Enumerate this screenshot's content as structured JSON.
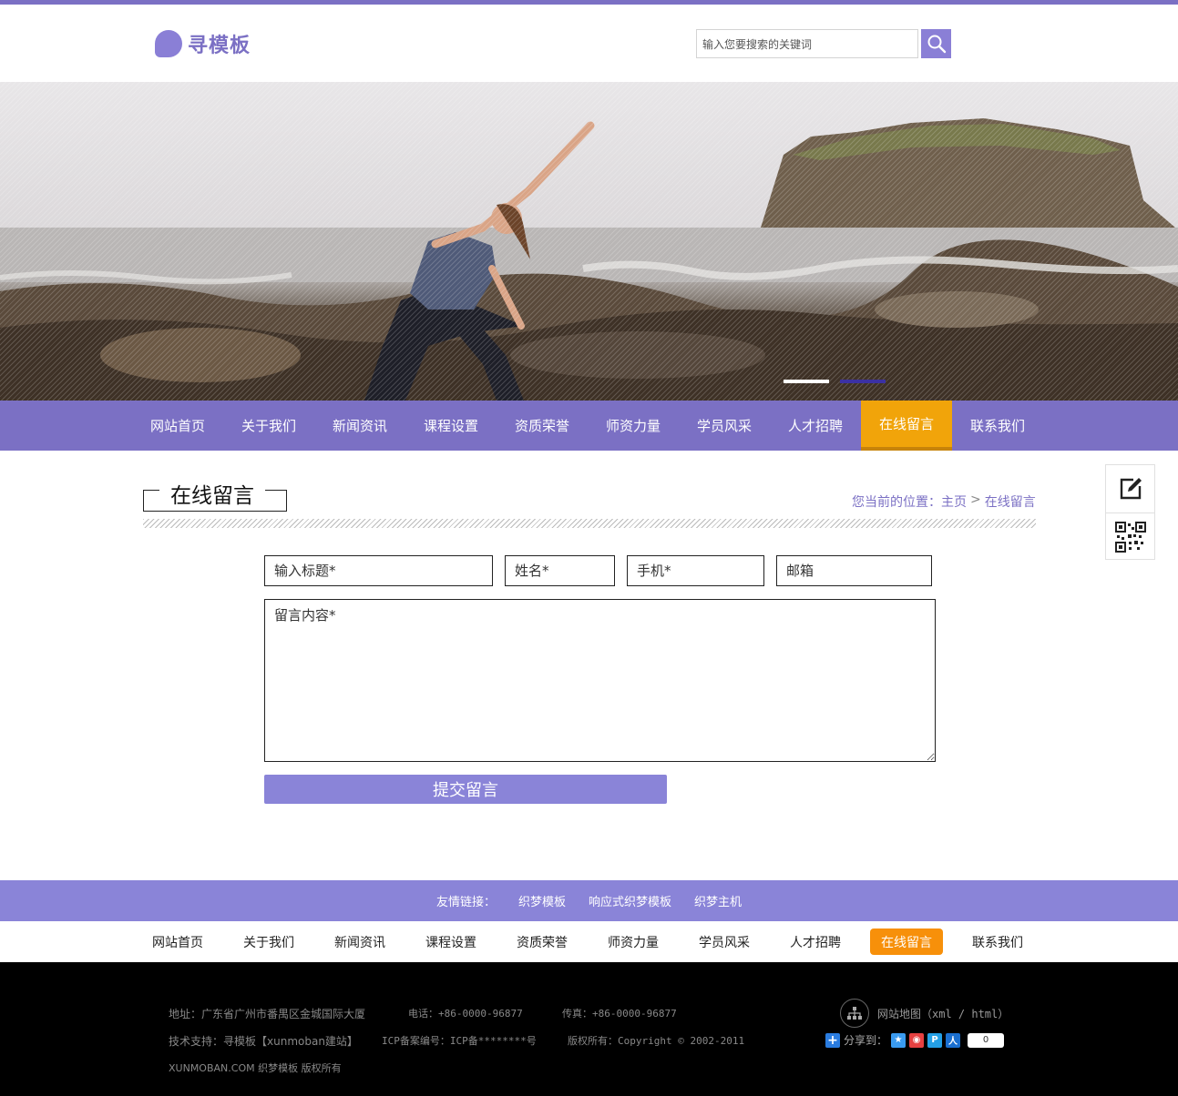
{
  "colors": {
    "brand": "#7b70c4",
    "accent": "#f1a40a",
    "footer_bg": "#000000",
    "links_bg": "#8a84d8"
  },
  "header": {
    "logo_text": "寻模板",
    "search": {
      "placeholder": "输入您要搜索的关键词",
      "value": "输入您要搜索的关键词",
      "button_icon": "search-icon"
    }
  },
  "banner": {
    "slides": 2,
    "active_slide": 2
  },
  "nav": {
    "items": [
      "网站首页",
      "关于我们",
      "新闻资讯",
      "课程设置",
      "资质荣誉",
      "师资力量",
      "学员风采",
      "人才招聘",
      "在线留言",
      "联系我们"
    ],
    "active": "在线留言"
  },
  "side_tools": {
    "items": [
      "edit-icon",
      "qr-code-icon"
    ]
  },
  "page": {
    "title": "在线留言",
    "breadcrumb": {
      "prefix": "您当前的位置：",
      "home": "主页",
      "separator": ">",
      "current": "在线留言"
    }
  },
  "form": {
    "title_placeholder": "输入标题*",
    "name_placeholder": "姓名*",
    "phone_placeholder": "手机*",
    "email_placeholder": "邮箱",
    "content_placeholder": "留言内容*",
    "submit_label": "提交留言"
  },
  "links": {
    "label": "友情链接：",
    "items": [
      "织梦模板",
      "响应式织梦模板",
      "织梦主机"
    ]
  },
  "footer_nav": {
    "items": [
      "网站首页",
      "关于我们",
      "新闻资讯",
      "课程设置",
      "资质荣誉",
      "师资力量",
      "学员风采",
      "人才招聘",
      "在线留言",
      "联系我们"
    ],
    "active": "在线留言"
  },
  "footer": {
    "address": "地址：广东省广州市番禺区金城国际大厦",
    "phone": "电话：+86-0000-96877",
    "fax": "传真：+86-0000-96877",
    "support": "技术支持：寻模板【xunmoban建站】",
    "icp": "ICP备案编号：ICP备********号",
    "copyright": "版权所有：Copyright © 2002-2011",
    "brand": "XUNMOBAN.COM 织梦模板 版权所有",
    "sitemap_label": "网站地图（xml / html）",
    "share_label": "分享到：",
    "share_count": "0"
  }
}
